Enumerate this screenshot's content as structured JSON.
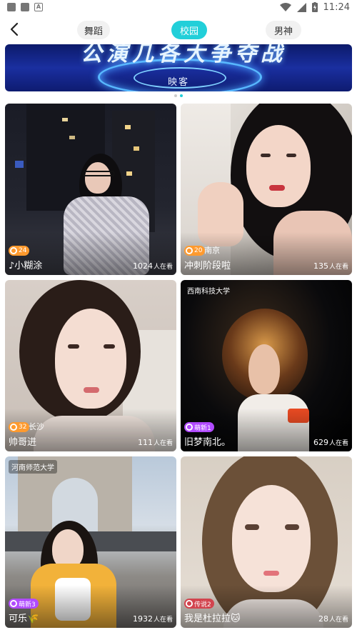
{
  "status_bar": {
    "time": "11:24",
    "battery_level": "charging"
  },
  "header": {
    "tabs": [
      {
        "label": "舞蹈",
        "active": false
      },
      {
        "label": "校园",
        "active": true
      },
      {
        "label": "男神",
        "active": false
      }
    ]
  },
  "banner": {
    "headline": "公演几各大争夺战",
    "subtitle": "映客"
  },
  "carousel": {
    "pages": 2,
    "current": 2
  },
  "cards": [
    {
      "name": "小糊涂",
      "level": "24",
      "badge_type": "level",
      "city": "",
      "school": "",
      "viewers": "1024",
      "viewers_suffix": "人在看"
    },
    {
      "name": "冲刺阶段啦",
      "level": "20",
      "badge_type": "level",
      "city": "南京",
      "school": "",
      "viewers": "135",
      "viewers_suffix": "人在看"
    },
    {
      "name": "帅哥进",
      "level": "32",
      "badge_type": "level",
      "city": "长沙",
      "school": "",
      "viewers": "111",
      "viewers_suffix": "人在看"
    },
    {
      "name": "旧梦南北。",
      "level": "萌新1",
      "badge_type": "newbie",
      "city": "",
      "school": "西南科技大学",
      "viewers": "629",
      "viewers_suffix": "人在看"
    },
    {
      "name": "可乐",
      "level": "萌新3",
      "badge_type": "newbie",
      "city": "",
      "school": "河南师范大学",
      "viewers": "1932",
      "viewers_suffix": "人在看"
    },
    {
      "name": "我是杜拉拉",
      "level": "传说2",
      "badge_type": "legend",
      "city": "",
      "school": "",
      "viewers": "28",
      "viewers_suffix": "人在看"
    }
  ],
  "colors": {
    "accent": "#22cfd9",
    "level_badge": "#ff9a2e",
    "newbie_badge": "#b14bff"
  }
}
